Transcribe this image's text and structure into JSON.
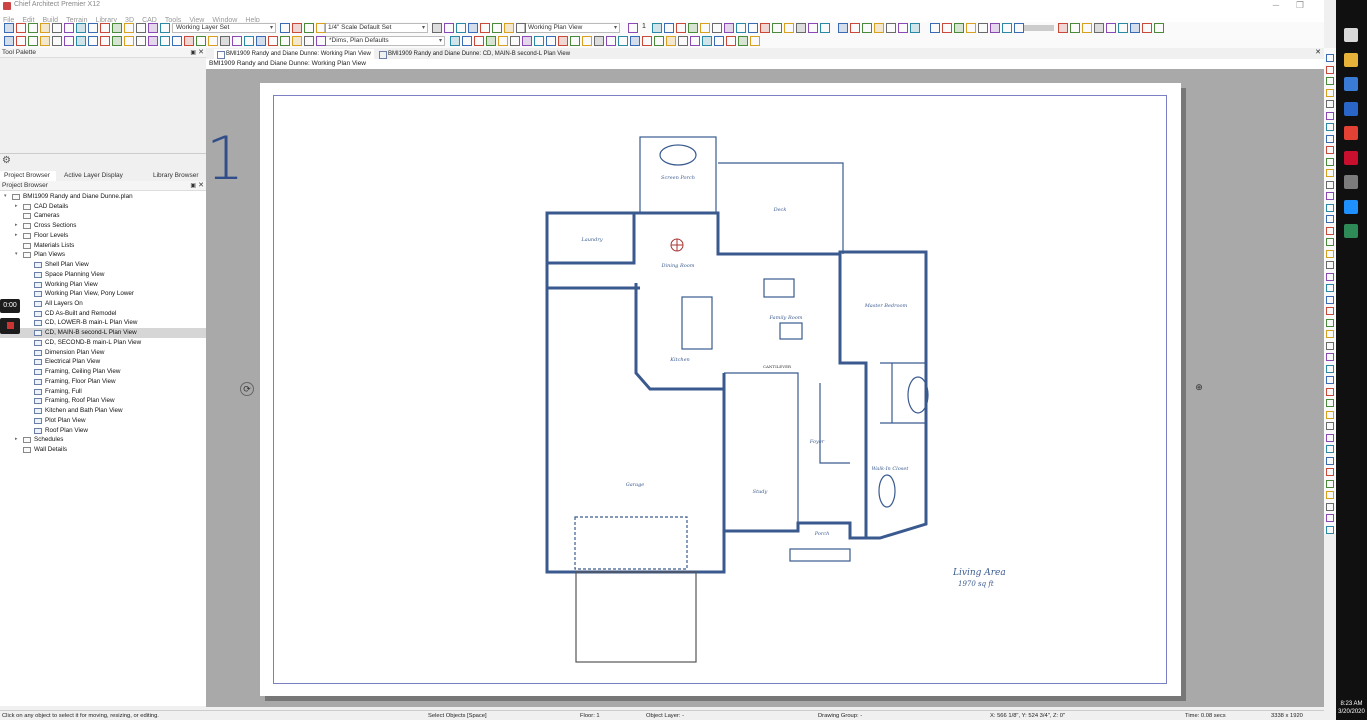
{
  "window": {
    "title": "Chief Architect Premier X12",
    "controls": [
      "─",
      "❐",
      "✕"
    ]
  },
  "menu": [
    "File",
    "Edit",
    "Build",
    "Terrain",
    "Library",
    "3D",
    "CAD",
    "Tools",
    "View",
    "Window",
    "Help"
  ],
  "toolbar": {
    "layer_set": "Working Layer Set",
    "scale": "1/4\" Scale Default Set",
    "plan_view": "Working Plan View",
    "floor": "1",
    "dims": "*Dims, Plan Defaults"
  },
  "tool_palette": {
    "title": "Tool Palette"
  },
  "tabs": [
    {
      "label": "Project Browser"
    },
    {
      "label": "Active Layer Display Options"
    },
    {
      "label": "Library Browser"
    }
  ],
  "project_browser": {
    "title": "Project Browser",
    "items": [
      {
        "label": "BMI1909 Randy and Diane Dunne.plan"
      },
      {
        "label": "CAD Details"
      },
      {
        "label": "Cameras"
      },
      {
        "label": "Cross Sections"
      },
      {
        "label": "Floor Levels"
      },
      {
        "label": "Materials Lists"
      },
      {
        "label": "Plan Views"
      },
      {
        "label": "Shell Plan View"
      },
      {
        "label": "Space Planning View"
      },
      {
        "label": "Working Plan View"
      },
      {
        "label": "Working Plan View, Pony Lower"
      },
      {
        "label": "All Layers On"
      },
      {
        "label": "CD As-Built and Remodel"
      },
      {
        "label": "CD, LOWER-B main-L Plan View"
      },
      {
        "label": "CD, MAIN-B second-L Plan View"
      },
      {
        "label": "CD, SECOND-B main-L Plan View"
      },
      {
        "label": "Dimension Plan View"
      },
      {
        "label": "Electrical Plan View"
      },
      {
        "label": "Framing, Ceiling Plan View"
      },
      {
        "label": "Framing, Floor Plan View"
      },
      {
        "label": "Framing, Full"
      },
      {
        "label": "Framing, Roof Plan View"
      },
      {
        "label": "Kitchen and Bath Plan View"
      },
      {
        "label": "Plot Plan View"
      },
      {
        "label": "Roof Plan View"
      },
      {
        "label": "Schedules"
      },
      {
        "label": "Wall Details"
      }
    ]
  },
  "recorder": {
    "time": "0:00"
  },
  "doc_tabs": [
    {
      "label": "BMI1909 Randy and Diane Dunne:  Working Plan View"
    },
    {
      "label": "BMI1909 Randy and Diane Dunne: CD, MAIN-B second-L Plan View"
    }
  ],
  "view_title": "BMI1909 Randy and Diane Dunne:  Working Plan View",
  "overlay_number": "1",
  "plan": {
    "rooms": {
      "screen_porch": "Screen Porch",
      "deck": "Deck",
      "laundry": "Laundry",
      "dining": "Dining Room",
      "family": "Family Room",
      "master": "Master Bedroom",
      "kitchen": "Kitchen",
      "cantilever": "CANTILEVER",
      "foyer": "Foyer",
      "walkin": "Walk-In Closet",
      "garage": "Garage",
      "study": "Study",
      "porch": "Porch"
    },
    "area_title": "Living Area",
    "area_value": "1970 sq ft"
  },
  "status": {
    "hint": "Click on any object to select it for moving, resizing, or editing.",
    "mode": "Select Objects [Space]",
    "floor": "Floor: 1",
    "layer": "Object Layer: -",
    "group": "Drawing Group: -",
    "coords": "X: 566 1/8\", Y: 524 3/4\", Z: 0\"",
    "time": "Time: 0.08 secs",
    "resolution": "3338 x 1920"
  },
  "clock": {
    "time": "8:23 AM",
    "date": "3/20/2020"
  },
  "colors": {
    "wall": "#3a5a8f",
    "sheet_border": "#7b7fc4",
    "canvas": "#a9a9a9"
  }
}
